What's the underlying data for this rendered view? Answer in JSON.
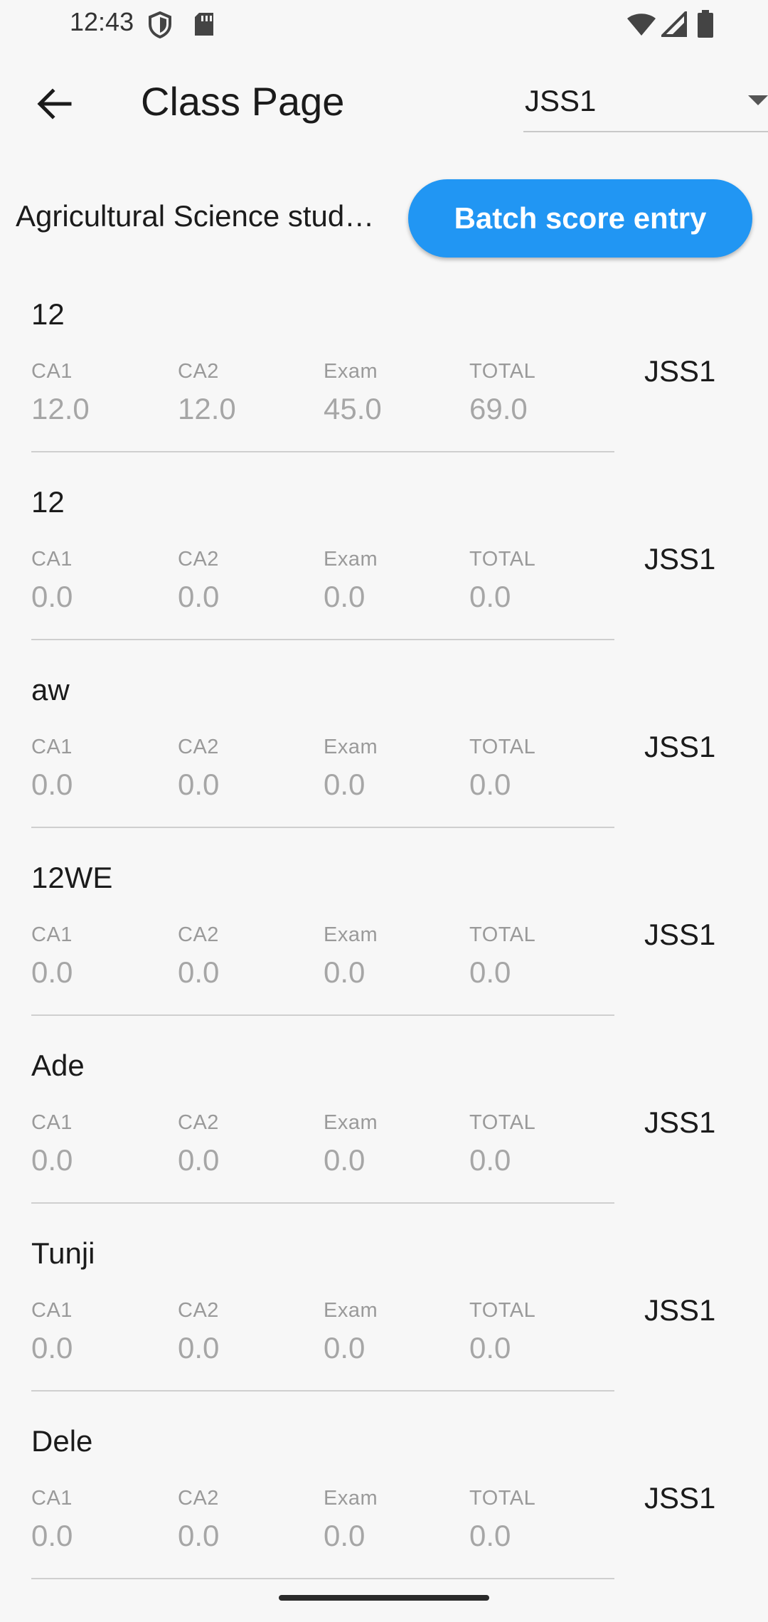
{
  "status_bar": {
    "time": "12:43"
  },
  "app_bar": {
    "title": "Class Page",
    "class_dropdown": {
      "selected": "JSS1"
    }
  },
  "subject": {
    "label": "Agricultural Science stud…",
    "batch_button_label": "Batch score entry"
  },
  "column_labels": {
    "ca1": "CA1",
    "ca2": "CA2",
    "exam": "Exam",
    "total": "TOTAL"
  },
  "students": [
    {
      "name": "12",
      "ca1": "12.0",
      "ca2": "12.0",
      "exam": "45.0",
      "total": "69.0",
      "class": "JSS1"
    },
    {
      "name": "12",
      "ca1": "0.0",
      "ca2": "0.0",
      "exam": "0.0",
      "total": "0.0",
      "class": "JSS1"
    },
    {
      "name": "aw",
      "ca1": "0.0",
      "ca2": "0.0",
      "exam": "0.0",
      "total": "0.0",
      "class": "JSS1"
    },
    {
      "name": "12WE",
      "ca1": "0.0",
      "ca2": "0.0",
      "exam": "0.0",
      "total": "0.0",
      "class": "JSS1"
    },
    {
      "name": "Ade",
      "ca1": "0.0",
      "ca2": "0.0",
      "exam": "0.0",
      "total": "0.0",
      "class": "JSS1"
    },
    {
      "name": "Tunji",
      "ca1": "0.0",
      "ca2": "0.0",
      "exam": "0.0",
      "total": "0.0",
      "class": "JSS1"
    },
    {
      "name": "Dele",
      "ca1": "0.0",
      "ca2": "0.0",
      "exam": "0.0",
      "total": "0.0",
      "class": "JSS1"
    }
  ],
  "colors": {
    "accent": "#2196f3",
    "background": "#f7f7f7",
    "muted_text": "#a6a6a6"
  },
  "icons": {
    "back": "arrow-back-icon",
    "shield": "shield-icon",
    "sd_card": "sd-card-icon",
    "wifi": "wifi-icon",
    "signal": "cell-signal-icon",
    "battery": "battery-icon"
  }
}
